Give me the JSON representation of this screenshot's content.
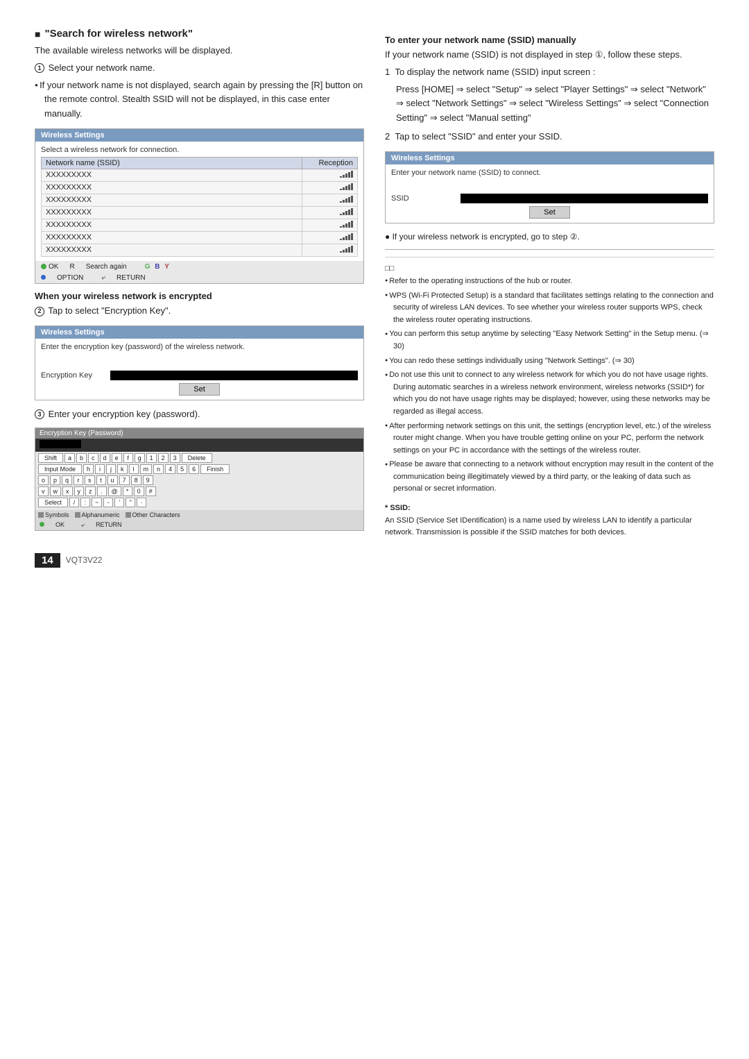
{
  "page": {
    "number": "14",
    "doc_code": "VQT3V22"
  },
  "left_column": {
    "section_heading": "\"Search for wireless network\"",
    "intro_text": "The available wireless networks will be displayed.",
    "step1_label": "① Select your network name.",
    "bullet_items": [
      "If your network name is not displayed, search again by pressing the [R] button on the remote control. Stealth SSID will not be displayed, in this case enter manually."
    ],
    "wireless_box1": {
      "title": "Wireless Settings",
      "subtitle": "Select a wireless network for connection.",
      "col_network": "Network name (SSID)",
      "col_reception": "Reception",
      "networks": [
        "XXXXXXXXX",
        "XXXXXXXXX",
        "XXXXXXXXX",
        "XXXXXXXXX",
        "XXXXXXXXX",
        "XXXXXXXXX",
        "XXXXXXXXX"
      ],
      "ok_label": "OK",
      "search_again_label": "Search again",
      "option_label": "OPTION",
      "return_label": "RETURN"
    },
    "when_encrypted_heading": "When your wireless network is encrypted",
    "step2_label": "② Tap to select \"Encryption Key\".",
    "wireless_box2": {
      "title": "Wireless Settings",
      "subtitle": "Enter the encryption key (password) of the wireless network.",
      "field_label": "Encryption Key",
      "set_label": "Set"
    },
    "step3_label": "③ Enter your encryption key (password).",
    "keyboard_box": {
      "title": "Encryption Key (Password)",
      "rows": [
        [
          "Shift",
          "a",
          "b",
          "c",
          "d",
          "e",
          "f",
          "g",
          "1",
          "2",
          "3",
          "Delete"
        ],
        [
          "Input Mode",
          "h",
          "i",
          "j",
          "k",
          "l",
          "m",
          "n",
          "4",
          "5",
          "6",
          "Finish"
        ],
        [
          "o",
          "p",
          "q",
          "r",
          "s",
          "t",
          "u",
          "7",
          "8",
          "9"
        ],
        [
          "v",
          "w",
          "x",
          "y",
          "z",
          ".",
          "@",
          "*",
          "0",
          "#"
        ],
        [
          "Select",
          "/",
          ":",
          "~",
          "-",
          "'",
          "\"",
          "·"
        ]
      ],
      "footer_items": [
        "■ Symbols",
        "■ Alphanumeric",
        "■ Other Characters"
      ],
      "ok_label": "OK",
      "return_label": "RETURN"
    }
  },
  "right_column": {
    "manual_ssid_heading": "To enter your network name (SSID) manually",
    "manual_ssid_intro": "If your network name (SSID) is not displayed in step ①, follow these steps.",
    "step1": "To display the network name (SSID) input screen :",
    "step1_detail": "Press [HOME] ⇒ select \"Setup\" ⇒ select \"Player Settings\" ⇒ select \"Network\" ⇒ select \"Network Settings\" ⇒ select \"Wireless Settings\" ⇒ select \"Connection Setting\" ⇒ select \"Manual setting\"",
    "step2": "Tap to select \"SSID\" and enter your SSID.",
    "wireless_box3": {
      "title": "Wireless Settings",
      "subtitle": "Enter your network name (SSID) to connect.",
      "ssid_label": "SSID",
      "set_label": "Set"
    },
    "encrypted_note": "● If your wireless network is encrypted, go to step ②.",
    "notes_heading": "□□",
    "notes": [
      "Refer to the operating instructions of the hub or router.",
      "WPS (Wi-Fi Protected Setup) is a standard that facilitates settings relating to the connection and security of wireless LAN devices. To see whether your wireless router supports WPS, check the wireless router operating instructions.",
      "You can perform this setup anytime by selecting \"Easy Network Setting\" in the Setup menu. (⇒ 30)",
      "You can redo these settings individually using \"Network Settings\". (⇒ 30)",
      "Do not use this unit to connect to any wireless network for which you do not have usage rights. During automatic searches in a wireless network environment, wireless networks (SSID*) for which you do not have usage rights may be displayed; however, using these networks may be regarded as illegal access.",
      "After performing network settings on this unit, the settings (encryption level, etc.) of the wireless router might change. When you have trouble getting online on your PC, perform the network settings on your PC in accordance with the settings of the wireless router.",
      "Please be aware that connecting to a network without encryption may result in the content of the communication being illegitimately viewed by a third party, or the leaking of data such as personal or secret information."
    ],
    "ssid_note_title": "* SSID:",
    "ssid_note_text": "An SSID (Service Set IDentification) is a name used by wireless LAN to identify a particular network. Transmission is possible if the SSID matches for both devices."
  }
}
